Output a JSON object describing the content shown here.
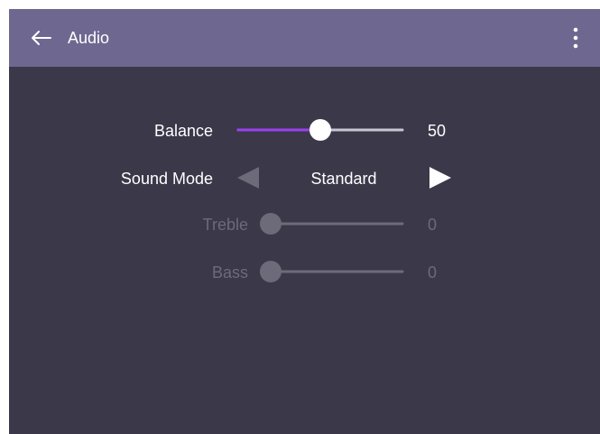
{
  "header": {
    "title": "Audio",
    "back_icon": "arrow-left-icon",
    "menu_icon": "more-vertical-icon"
  },
  "colors": {
    "header_bg": "#6e6891",
    "panel_bg": "#3b3849",
    "accent": "#9b3ff0",
    "disabled": "#6d6a79"
  },
  "settings": {
    "balance": {
      "label": "Balance",
      "value": "50",
      "level": 0.5
    },
    "sound_mode": {
      "label": "Sound Mode",
      "value": "Standard",
      "prev_icon": "triangle-left-icon",
      "next_icon": "triangle-right-icon"
    },
    "treble": {
      "label": "Treble",
      "value": "0",
      "level": 0,
      "enabled": false
    },
    "bass": {
      "label": "Bass",
      "value": "0",
      "level": 0,
      "enabled": false
    }
  }
}
